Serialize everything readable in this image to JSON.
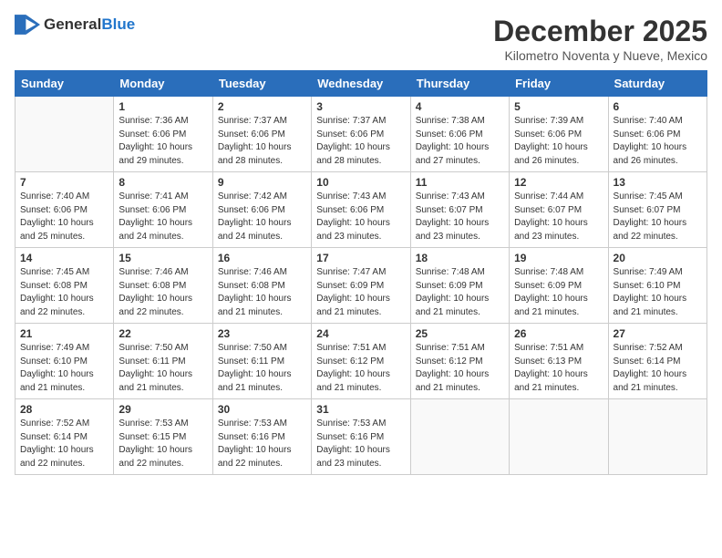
{
  "header": {
    "logo_general": "General",
    "logo_blue": "Blue",
    "month": "December 2025",
    "location": "Kilometro Noventa y Nueve, Mexico"
  },
  "days_of_week": [
    "Sunday",
    "Monday",
    "Tuesday",
    "Wednesday",
    "Thursday",
    "Friday",
    "Saturday"
  ],
  "weeks": [
    [
      {
        "day": "",
        "info": ""
      },
      {
        "day": "1",
        "info": "Sunrise: 7:36 AM\nSunset: 6:06 PM\nDaylight: 10 hours\nand 29 minutes."
      },
      {
        "day": "2",
        "info": "Sunrise: 7:37 AM\nSunset: 6:06 PM\nDaylight: 10 hours\nand 28 minutes."
      },
      {
        "day": "3",
        "info": "Sunrise: 7:37 AM\nSunset: 6:06 PM\nDaylight: 10 hours\nand 28 minutes."
      },
      {
        "day": "4",
        "info": "Sunrise: 7:38 AM\nSunset: 6:06 PM\nDaylight: 10 hours\nand 27 minutes."
      },
      {
        "day": "5",
        "info": "Sunrise: 7:39 AM\nSunset: 6:06 PM\nDaylight: 10 hours\nand 26 minutes."
      },
      {
        "day": "6",
        "info": "Sunrise: 7:40 AM\nSunset: 6:06 PM\nDaylight: 10 hours\nand 26 minutes."
      }
    ],
    [
      {
        "day": "7",
        "info": "Sunrise: 7:40 AM\nSunset: 6:06 PM\nDaylight: 10 hours\nand 25 minutes."
      },
      {
        "day": "8",
        "info": "Sunrise: 7:41 AM\nSunset: 6:06 PM\nDaylight: 10 hours\nand 24 minutes."
      },
      {
        "day": "9",
        "info": "Sunrise: 7:42 AM\nSunset: 6:06 PM\nDaylight: 10 hours\nand 24 minutes."
      },
      {
        "day": "10",
        "info": "Sunrise: 7:43 AM\nSunset: 6:06 PM\nDaylight: 10 hours\nand 23 minutes."
      },
      {
        "day": "11",
        "info": "Sunrise: 7:43 AM\nSunset: 6:07 PM\nDaylight: 10 hours\nand 23 minutes."
      },
      {
        "day": "12",
        "info": "Sunrise: 7:44 AM\nSunset: 6:07 PM\nDaylight: 10 hours\nand 23 minutes."
      },
      {
        "day": "13",
        "info": "Sunrise: 7:45 AM\nSunset: 6:07 PM\nDaylight: 10 hours\nand 22 minutes."
      }
    ],
    [
      {
        "day": "14",
        "info": "Sunrise: 7:45 AM\nSunset: 6:08 PM\nDaylight: 10 hours\nand 22 minutes."
      },
      {
        "day": "15",
        "info": "Sunrise: 7:46 AM\nSunset: 6:08 PM\nDaylight: 10 hours\nand 22 minutes."
      },
      {
        "day": "16",
        "info": "Sunrise: 7:46 AM\nSunset: 6:08 PM\nDaylight: 10 hours\nand 21 minutes."
      },
      {
        "day": "17",
        "info": "Sunrise: 7:47 AM\nSunset: 6:09 PM\nDaylight: 10 hours\nand 21 minutes."
      },
      {
        "day": "18",
        "info": "Sunrise: 7:48 AM\nSunset: 6:09 PM\nDaylight: 10 hours\nand 21 minutes."
      },
      {
        "day": "19",
        "info": "Sunrise: 7:48 AM\nSunset: 6:09 PM\nDaylight: 10 hours\nand 21 minutes."
      },
      {
        "day": "20",
        "info": "Sunrise: 7:49 AM\nSunset: 6:10 PM\nDaylight: 10 hours\nand 21 minutes."
      }
    ],
    [
      {
        "day": "21",
        "info": "Sunrise: 7:49 AM\nSunset: 6:10 PM\nDaylight: 10 hours\nand 21 minutes."
      },
      {
        "day": "22",
        "info": "Sunrise: 7:50 AM\nSunset: 6:11 PM\nDaylight: 10 hours\nand 21 minutes."
      },
      {
        "day": "23",
        "info": "Sunrise: 7:50 AM\nSunset: 6:11 PM\nDaylight: 10 hours\nand 21 minutes."
      },
      {
        "day": "24",
        "info": "Sunrise: 7:51 AM\nSunset: 6:12 PM\nDaylight: 10 hours\nand 21 minutes."
      },
      {
        "day": "25",
        "info": "Sunrise: 7:51 AM\nSunset: 6:12 PM\nDaylight: 10 hours\nand 21 minutes."
      },
      {
        "day": "26",
        "info": "Sunrise: 7:51 AM\nSunset: 6:13 PM\nDaylight: 10 hours\nand 21 minutes."
      },
      {
        "day": "27",
        "info": "Sunrise: 7:52 AM\nSunset: 6:14 PM\nDaylight: 10 hours\nand 21 minutes."
      }
    ],
    [
      {
        "day": "28",
        "info": "Sunrise: 7:52 AM\nSunset: 6:14 PM\nDaylight: 10 hours\nand 22 minutes."
      },
      {
        "day": "29",
        "info": "Sunrise: 7:53 AM\nSunset: 6:15 PM\nDaylight: 10 hours\nand 22 minutes."
      },
      {
        "day": "30",
        "info": "Sunrise: 7:53 AM\nSunset: 6:16 PM\nDaylight: 10 hours\nand 22 minutes."
      },
      {
        "day": "31",
        "info": "Sunrise: 7:53 AM\nSunset: 6:16 PM\nDaylight: 10 hours\nand 23 minutes."
      },
      {
        "day": "",
        "info": ""
      },
      {
        "day": "",
        "info": ""
      },
      {
        "day": "",
        "info": ""
      }
    ]
  ]
}
